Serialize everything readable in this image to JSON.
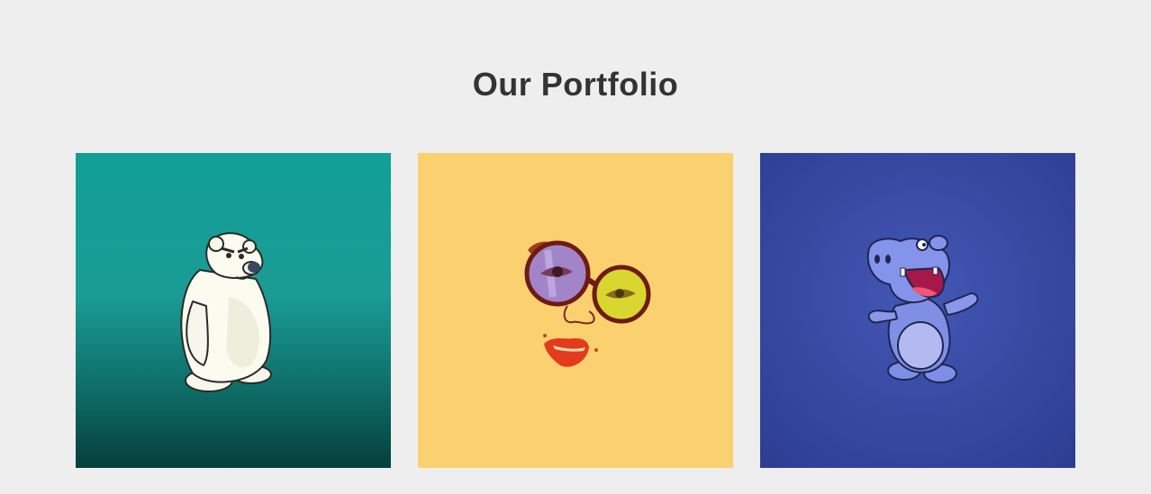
{
  "portfolio": {
    "title": "Our Portfolio",
    "items": [
      {
        "subject": "polar-bear",
        "background": "#16a39a"
      },
      {
        "subject": "face-with-glasses",
        "background": "#fbd16f"
      },
      {
        "subject": "hippo",
        "background": "#3a4ea8"
      }
    ]
  }
}
